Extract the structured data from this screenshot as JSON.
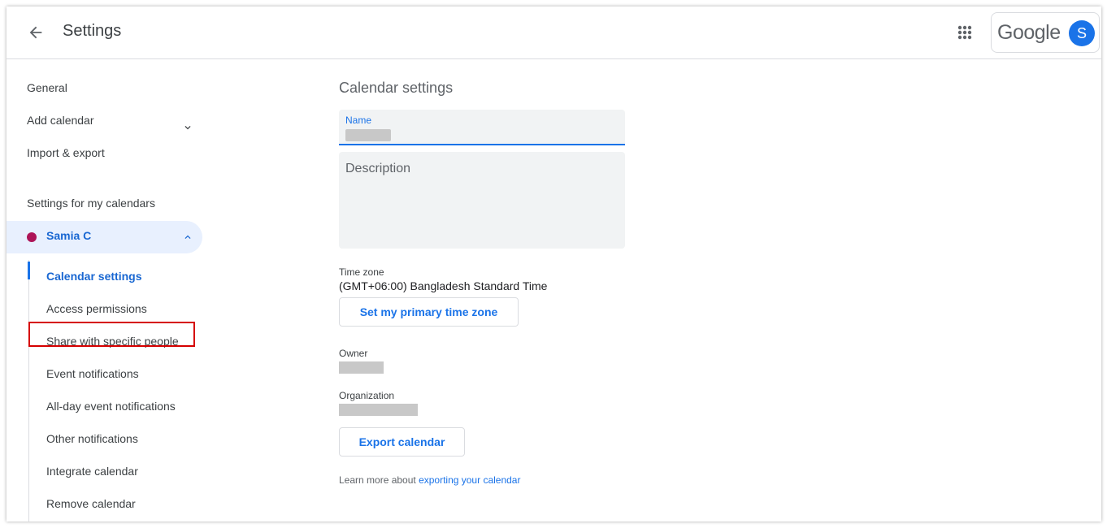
{
  "header": {
    "title": "Settings",
    "logo_text": "Google",
    "avatar_letter": "S"
  },
  "sidebar": {
    "general": "General",
    "add_calendar": "Add calendar",
    "import_export": "Import & export",
    "section_heading": "Settings for my calendars",
    "calendar_name": "Samia C",
    "calendar_color": "#ad1457",
    "sub_items": [
      "Calendar settings",
      "Access permissions",
      "Share with specific people",
      "Event notifications",
      "All-day event notifications",
      "Other notifications",
      "Integrate calendar",
      "Remove calendar"
    ]
  },
  "main": {
    "title": "Calendar settings",
    "name_label": "Name",
    "description_placeholder": "Description",
    "timezone_label": "Time zone",
    "timezone_value": "(GMT+06:00) Bangladesh Standard Time",
    "set_timezone_button": "Set my primary time zone",
    "owner_label": "Owner",
    "organization_label": "Organization",
    "export_button": "Export calendar",
    "learn_more_prefix": "Learn more about ",
    "learn_more_link": "exporting your calendar"
  },
  "colors": {
    "accent": "#1a73e8",
    "selected_bg": "#e8f0fe",
    "highlight_border": "#d50000"
  }
}
